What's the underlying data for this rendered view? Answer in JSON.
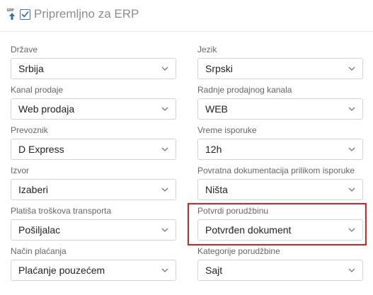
{
  "header": {
    "erp_icon_text": "ERP",
    "checkbox_checked": true,
    "title": "Pripremljno za ERP"
  },
  "fields": {
    "drzave": {
      "label": "Države",
      "value": "Srbija"
    },
    "jezik": {
      "label": "Jezik",
      "value": "Srpski"
    },
    "kanal_prodaje": {
      "label": "Kanal prodaje",
      "value": "Web prodaja"
    },
    "radnje_prodajnog_kanala": {
      "label": "Radnje prodajnog kanala",
      "value": "WEB"
    },
    "prevoznik": {
      "label": "Prevoznik",
      "value": "D Express"
    },
    "vreme_isporuke": {
      "label": "Vreme isporuke",
      "value": "12h"
    },
    "izvor": {
      "label": "Izvor",
      "value": "Izaberi"
    },
    "povratna_dokumentacija": {
      "label": "Povratna dokumentacija prilikom isporuke",
      "value": "Ništa"
    },
    "platisa": {
      "label": "Platiša troškova transporta",
      "value": "Pošiljalac"
    },
    "potvrdi_porudzbinu": {
      "label": "Potvrdi porudžbinu",
      "value": "Potvrđen dokument"
    },
    "nacin_placanja": {
      "label": "Način plaćanja",
      "value": "Plaćanje pouzećem"
    },
    "kategorije_porudzbine": {
      "label": "Kategorije porudžbine",
      "value": "Sajt"
    }
  },
  "colors": {
    "highlight": "#d42027",
    "checkbox_border": "#3c6fb0",
    "select_border": "#cfd4da"
  }
}
